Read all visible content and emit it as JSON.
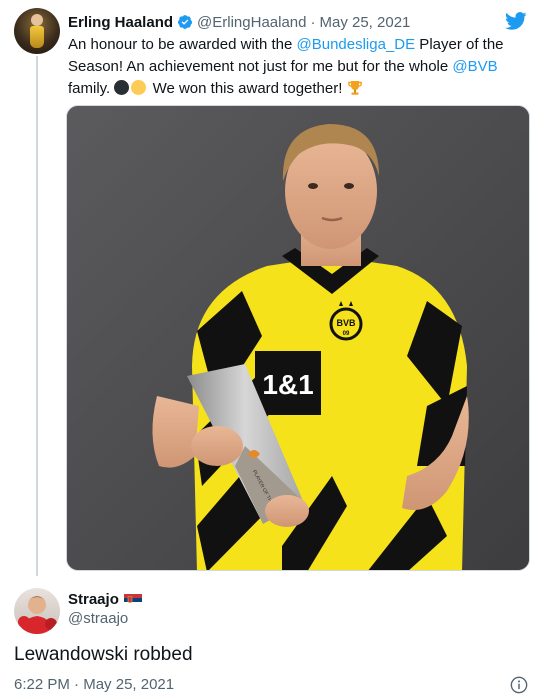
{
  "quoted_tweet": {
    "author_name": "Erling Haaland",
    "handle": "@ErlingHaaland",
    "separator": "·",
    "date": "May 25, 2021",
    "text_part1": "An honour to be awarded with the ",
    "mention1": "@Bundesliga_DE",
    "text_part2": " Player of the Season! An achievement not just for me but for the whole ",
    "mention2": "@BVB",
    "text_part3": " family. ",
    "text_part4": " We won this award together! ",
    "shirt_sponsor": "1&1",
    "crest_text": "BVB",
    "crest_year": "09",
    "trophy_text": "PLAYER OF THE SEASON"
  },
  "reply_tweet": {
    "author_name": "Straajo",
    "handle": "@straajo",
    "text": "Lewandowski robbed",
    "time": "6:22 PM",
    "separator": "·",
    "date": "May 25, 2021"
  },
  "colors": {
    "link": "#1d9bf0",
    "secondary_text": "#536471",
    "bvb_yellow": "#f5e21b",
    "bvb_black": "#111111",
    "photo_background": "#4f4f51"
  },
  "icons": {
    "verified": "verified-badge-icon",
    "brand": "twitter-bird-icon",
    "flag": "serbia-flag-icon",
    "trophy": "trophy-emoji-icon",
    "info": "info-icon"
  }
}
